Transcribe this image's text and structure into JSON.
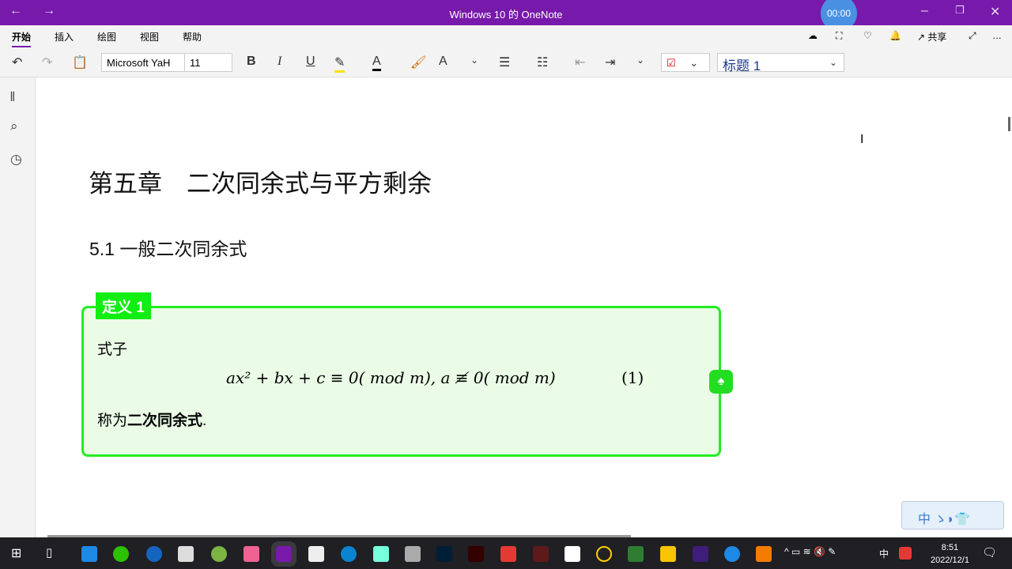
{
  "window": {
    "title": "Windows 10 的 OneNote",
    "timer": "00:00"
  },
  "menu": [
    "开始",
    "插入",
    "绘图",
    "视图",
    "帮助"
  ],
  "share": "共享",
  "toolbar": {
    "font": "Microsoft YaH",
    "size": "11",
    "style": "标题 1"
  },
  "page": {
    "heading": "第五章　二次同余式与平方剩余",
    "section": "5.1 一般二次同余式",
    "definition": {
      "tag": "定义 1",
      "intro": "式子",
      "equation": "ax² + bx + c ≡ 0(  mod m),  a ≢ 0(  mod m)",
      "eq_number": "(1)",
      "outro_prefix": "称为",
      "outro_bold": "二次同余式",
      "outro_suffix": "."
    }
  },
  "ime": "中",
  "taskbar": {
    "time": "8:51",
    "date": "2022/12/1",
    "tray_lang": "中"
  }
}
